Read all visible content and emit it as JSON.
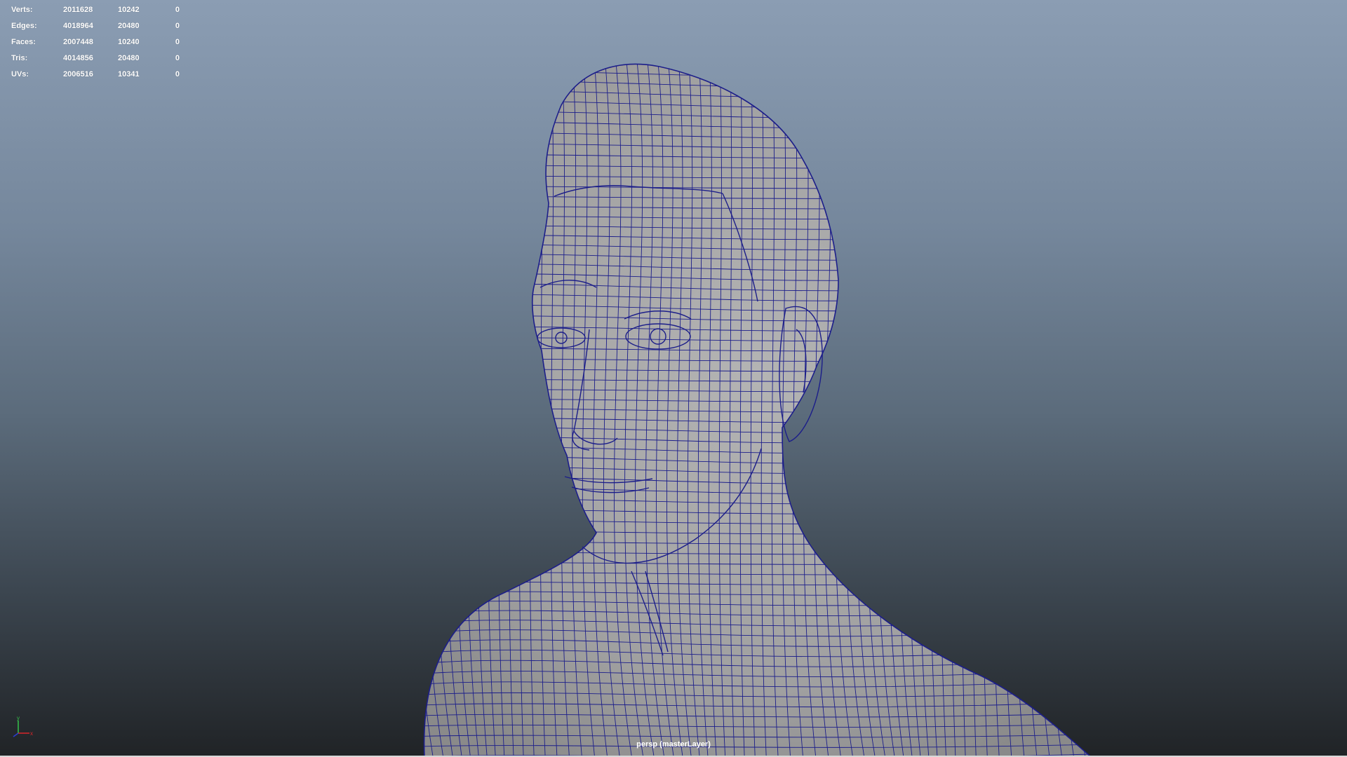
{
  "hud": {
    "rows": [
      {
        "label": "Verts:",
        "total": "2011628",
        "selected": "10242",
        "extra": "0"
      },
      {
        "label": "Edges:",
        "total": "4018964",
        "selected": "20480",
        "extra": "0"
      },
      {
        "label": "Faces:",
        "total": "2007448",
        "selected": "10240",
        "extra": "0"
      },
      {
        "label": "Tris:",
        "total": "4014856",
        "selected": "20480",
        "extra": "0"
      },
      {
        "label": "UVs:",
        "total": "2006516",
        "selected": "10341",
        "extra": "0"
      }
    ]
  },
  "viewport": {
    "camera_label": "persp (masterLayer)",
    "wire_color": "#1c1e8a",
    "shade_color": "#a3a3a3",
    "axis": {
      "y": "y",
      "x": "x",
      "y_color": "#35c24a",
      "x_color": "#d8262b",
      "z_color": "#2b3ed6"
    }
  }
}
